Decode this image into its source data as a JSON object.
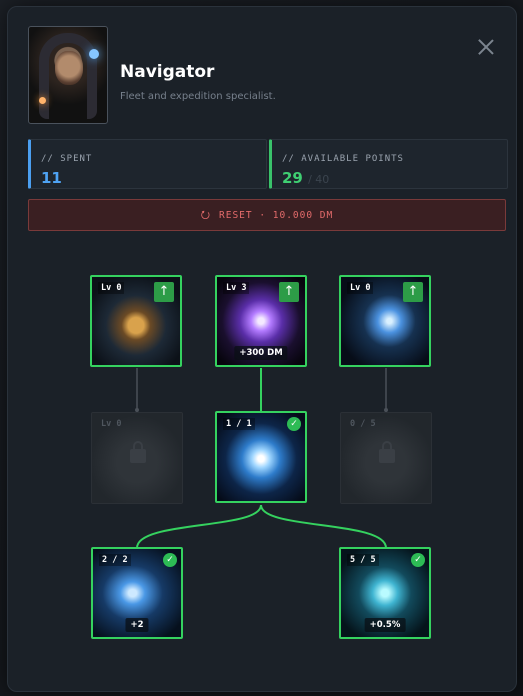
{
  "header": {
    "title": "Navigator",
    "subtitle": "Fleet and expedition specialist."
  },
  "stats": {
    "spent_label": "// SPENT",
    "spent_value": "11",
    "available_label": "// AVAILABLE POINTS",
    "available_value": "29",
    "available_max": "/ 40"
  },
  "reset": {
    "icon": "refresh-icon",
    "label": "RESET · 10.000 DM"
  },
  "colors": {
    "accent_green": "#35d25f",
    "accent_blue": "#4fa3f3",
    "danger": "#e36b6b",
    "panel_bg": "#1b2128"
  },
  "tree": {
    "top": [
      {
        "level": "Lv 0",
        "icon": "treasure-cargo-icon",
        "can_upgrade": true
      },
      {
        "level": "Lv 3",
        "icon": "vortex-icon",
        "can_upgrade": true,
        "bonus": "+300 DM"
      },
      {
        "level": "Lv 0",
        "icon": "fleet-ships-icon",
        "can_upgrade": true
      }
    ],
    "middle": [
      {
        "level": "Lv 0",
        "icon": "locked-ship-icon",
        "locked": true
      },
      {
        "level": "1 / 1",
        "icon": "starburst-icon",
        "completed": true
      },
      {
        "level": "0 / 5",
        "icon": "locked-asteroid-icon",
        "locked": true
      }
    ],
    "bottom": [
      {
        "level": "2 / 2",
        "icon": "warp-fleet-icon",
        "completed": true,
        "bonus": "+2"
      },
      {
        "level": "5 / 5",
        "icon": "crystal-ship-icon",
        "completed": true,
        "bonus": "+0.5%"
      }
    ]
  }
}
